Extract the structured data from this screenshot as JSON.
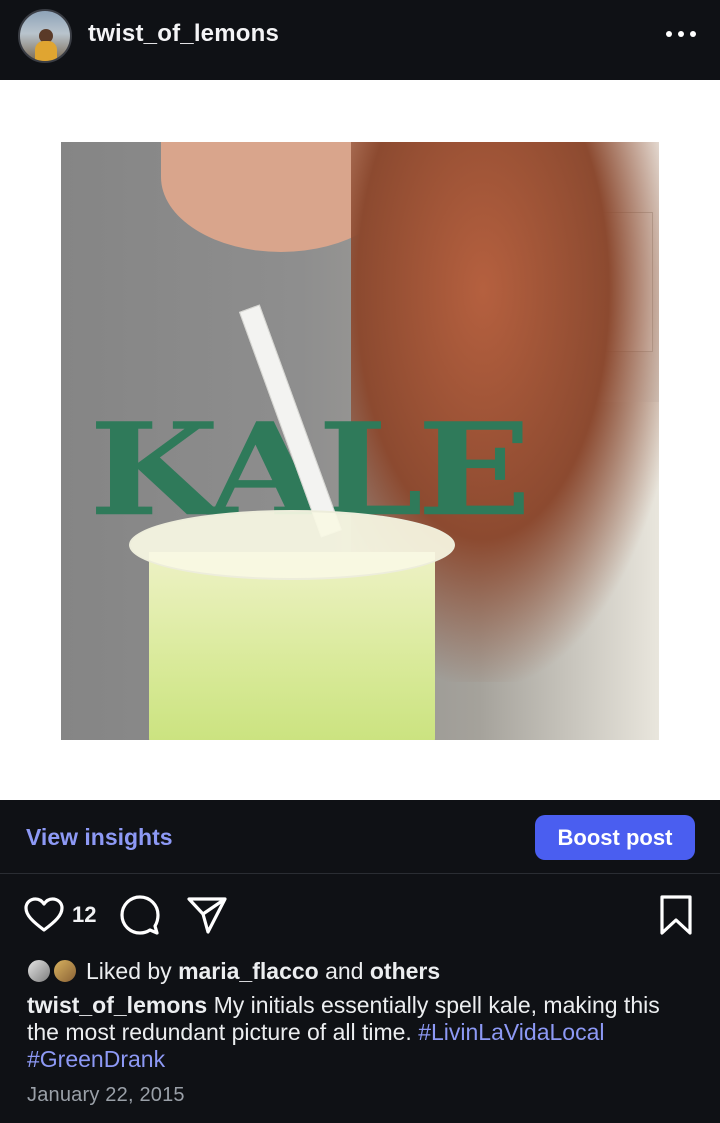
{
  "header": {
    "username": "twist_of_lemons",
    "more_icon": "more-horizontal-icon"
  },
  "post_image": {
    "shirt_text": "KALE"
  },
  "actions": {
    "view_insights": "View insights",
    "boost_post": "Boost post",
    "like_count": "12",
    "icons": [
      "heart-icon",
      "comment-icon",
      "share-icon",
      "bookmark-icon"
    ]
  },
  "likes": {
    "prefix": "Liked by",
    "user": "maria_flacco",
    "middle": "and",
    "suffix": "others"
  },
  "caption": {
    "username": "twist_of_lemons",
    "text": "My initials essentially spell kale, making this the most redundant picture of all time.",
    "hashtags": [
      "#LivinLaVidaLocal",
      "#GreenDrank"
    ]
  },
  "date": "January 22, 2015",
  "colors": {
    "background": "#0f1115",
    "accent_link": "#8d99f5",
    "boost_button": "#4a5ef0"
  }
}
